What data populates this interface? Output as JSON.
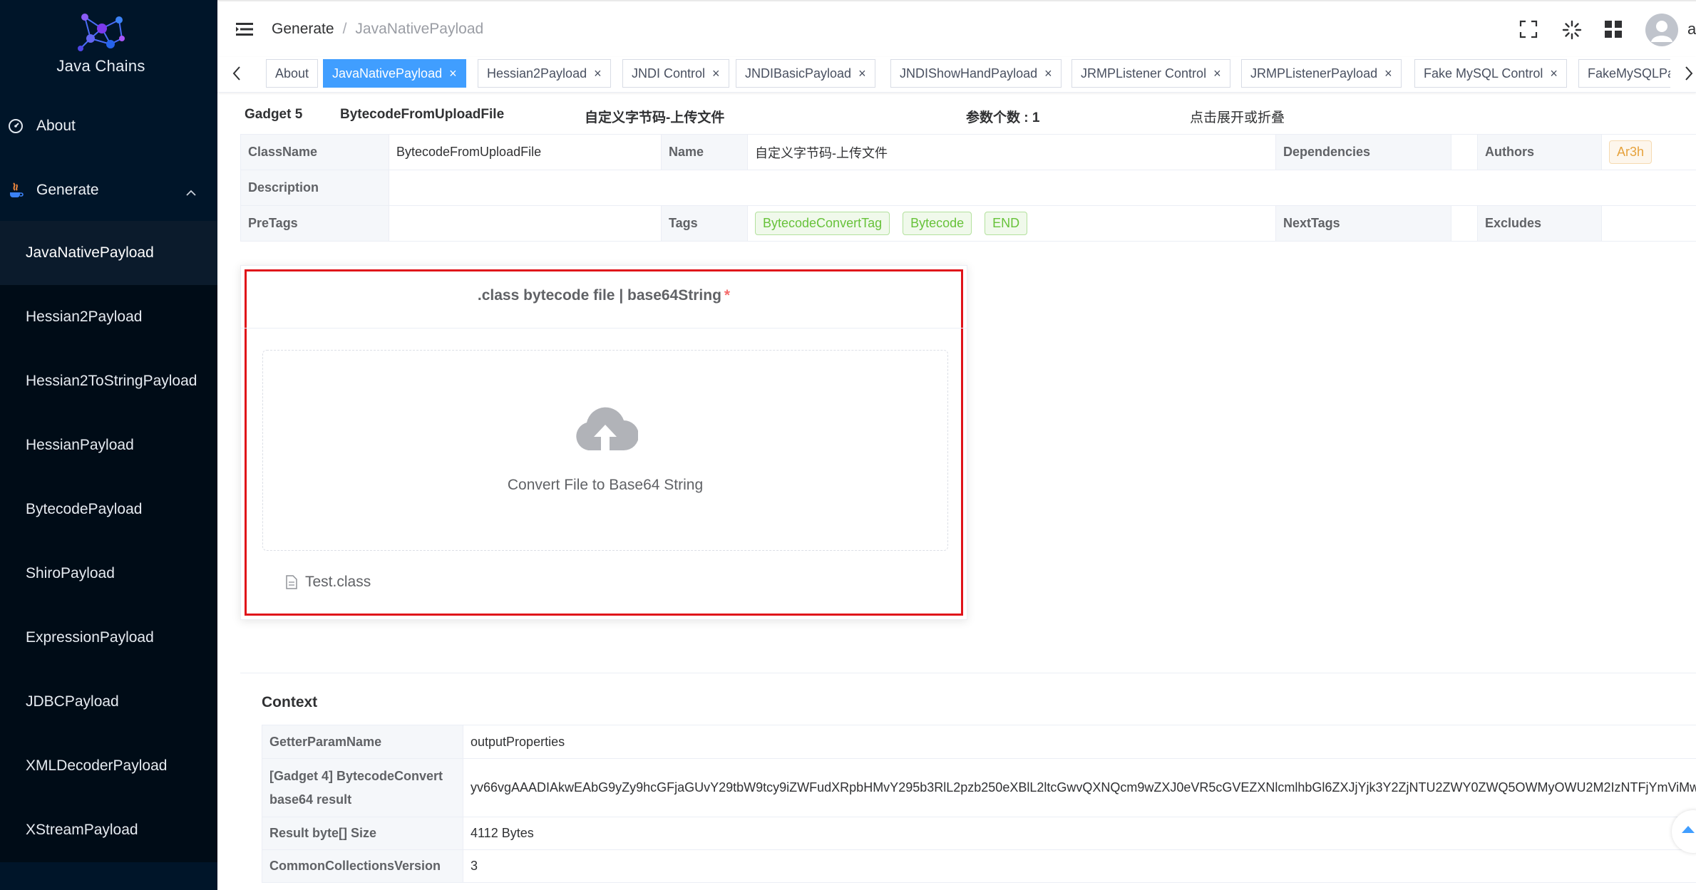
{
  "app": {
    "logo_text": "Java Chains"
  },
  "sidebar": {
    "about_label": "About",
    "generate_label": "Generate",
    "sub_items": [
      {
        "label": "JavaNativePayload"
      },
      {
        "label": "Hessian2Payload"
      },
      {
        "label": "Hessian2ToStringPayload"
      },
      {
        "label": "HessianPayload"
      },
      {
        "label": "BytecodePayload"
      },
      {
        "label": "ShiroPayload"
      },
      {
        "label": "ExpressionPayload"
      },
      {
        "label": "JDBCPayload"
      },
      {
        "label": "XMLDecoderPayload"
      },
      {
        "label": "XStreamPayload"
      }
    ]
  },
  "header": {
    "breadcrumb": [
      "Generate",
      "JavaNativePayload"
    ],
    "user_initial": "a"
  },
  "tabs": [
    {
      "label": "About"
    },
    {
      "label": "JavaNativePayload"
    },
    {
      "label": "Hessian2Payload"
    },
    {
      "label": "JNDI Control"
    },
    {
      "label": "JNDIBasicPayload"
    },
    {
      "label": "JNDIShowHandPayload"
    },
    {
      "label": "JRMPListener Control"
    },
    {
      "label": "JRMPListenerPayload"
    },
    {
      "label": "Fake MySQL Control"
    },
    {
      "label": "FakeMySQLPa"
    }
  ],
  "gadget": {
    "index": "Gadget 5",
    "class": "BytecodeFromUploadFile",
    "name": "自定义字节码-上传文件",
    "param_count": "参数个数 : 1",
    "toggle_hint": "点击展开或折叠"
  },
  "descriptions": {
    "classname_label": "ClassName",
    "classname_value": "BytecodeFromUploadFile",
    "name_label": "Name",
    "name_value": "自定义字节码-上传文件",
    "dependencies_label": "Dependencies",
    "authors_label": "Authors",
    "authors_value": "Ar3h",
    "description_label": "Description",
    "pretags_label": "PreTags",
    "tags_label": "Tags",
    "tags": [
      "BytecodeConvertTag",
      "Bytecode",
      "END"
    ],
    "nexttags_label": "NextTags",
    "excludes_label": "Excludes"
  },
  "upload": {
    "title": ".class bytecode file | base64String",
    "required_mark": "*",
    "drop_text": "Convert File to Base64 String",
    "file_name": "Test.class"
  },
  "context": {
    "title": "Context",
    "rows": [
      {
        "label": "GetterParamName",
        "value": "outputProperties"
      },
      {
        "label": "[Gadget 4] BytecodeConvert base64 result",
        "value": "yv66vgAAADIAkwEAbG9yZy9hcGFjaGUvY29tbW9tcy9iZWFudXRpbHMvY295b3RlL2pzb250eXBlL2ltcGwvQXNQcm9wZXJ0eVR5cGVEZXNlcmlhbGl6ZXJjYjk3Y2ZjNTU2ZWY0ZWQ5OWMyOWU2M2IzNTFjYmViMw"
      },
      {
        "label": "Result byte[] Size",
        "value": "4112 Bytes"
      },
      {
        "label": "CommonCollectionsVersion",
        "value": "3"
      }
    ]
  },
  "colors": {
    "accent": "#409eff",
    "sidebar_bg": "#001529",
    "highlight_border": "#e0131a",
    "tag_green": "#67c23a",
    "tag_orange": "#e6a23c"
  }
}
